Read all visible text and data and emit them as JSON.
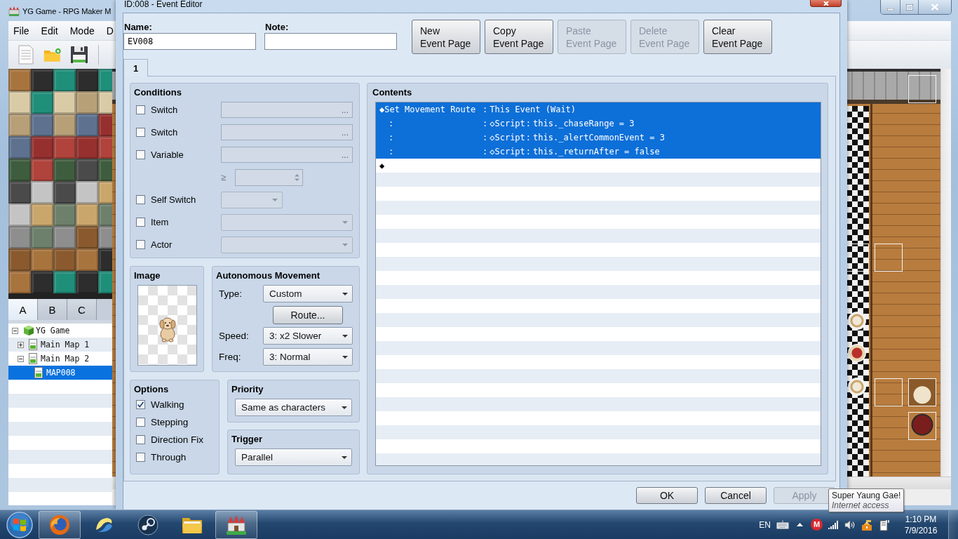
{
  "main_window": {
    "title": "YG Game - RPG Maker M",
    "menu": [
      "File",
      "Edit",
      "Mode",
      "D"
    ],
    "tile_tabs": [
      {
        "label": "A",
        "selected": true
      },
      {
        "label": "B",
        "selected": false
      },
      {
        "label": "C",
        "selected": false
      }
    ],
    "map_tree": [
      {
        "label": "YG Game",
        "kind": "project",
        "expanded": true,
        "selected": false,
        "children": [
          {
            "label": "Main Map 1",
            "kind": "map",
            "expanded": false,
            "selected": false
          },
          {
            "label": "Main Map 2",
            "kind": "map",
            "expanded": true,
            "selected": false,
            "children": [
              {
                "label": "MAP008",
                "kind": "map",
                "selected": true
              }
            ]
          }
        ]
      }
    ]
  },
  "event_editor": {
    "title": "ID:008 - Event Editor",
    "name": {
      "label": "Name:",
      "value": "EV008"
    },
    "note": {
      "label": "Note:"
    },
    "page_buttons": [
      {
        "lines": [
          "New",
          "Event Page"
        ],
        "disabled": false
      },
      {
        "lines": [
          "Copy",
          "Event Page"
        ],
        "disabled": false
      },
      {
        "lines": [
          "Paste",
          "Event Page"
        ],
        "disabled": true
      },
      {
        "lines": [
          "Delete",
          "Event Page"
        ],
        "disabled": true
      },
      {
        "lines": [
          "Clear",
          "Event Page"
        ],
        "disabled": false
      }
    ],
    "page_tabs": [
      {
        "label": "1",
        "selected": true
      }
    ],
    "conditions": {
      "title": "Conditions",
      "rows": [
        {
          "kind": "picker",
          "label": "Switch",
          "checked": false,
          "button": "..."
        },
        {
          "kind": "picker",
          "label": "Switch",
          "checked": false,
          "button": "..."
        },
        {
          "kind": "picker",
          "label": "Variable",
          "checked": false,
          "button": "...",
          "comparison": {
            "operator": "≥"
          }
        },
        {
          "kind": "short_dropdown",
          "label": "Self Switch",
          "checked": false
        },
        {
          "kind": "dropdown",
          "label": "Item",
          "checked": false
        },
        {
          "kind": "dropdown",
          "label": "Actor",
          "checked": false
        }
      ]
    },
    "image": {
      "title": "Image"
    },
    "autonomous_movement": {
      "title": "Autonomous Movement",
      "rows": [
        {
          "kind": "dropdown",
          "label": "Type:",
          "value": "Custom"
        },
        {
          "kind": "button",
          "label": "Route..."
        },
        {
          "kind": "dropdown",
          "label": "Speed:",
          "value": "3: x2 Slower"
        },
        {
          "kind": "dropdown",
          "label": "Freq:",
          "value": "3: Normal"
        }
      ]
    },
    "options": {
      "title": "Options",
      "items": [
        {
          "label": "Walking",
          "checked": true
        },
        {
          "label": "Stepping",
          "checked": false
        },
        {
          "label": "Direction Fix",
          "checked": false
        },
        {
          "label": "Through",
          "checked": false
        }
      ]
    },
    "priority": {
      "title": "Priority",
      "value": "Same as characters"
    },
    "trigger": {
      "title": "Trigger",
      "value": "Parallel"
    },
    "contents": {
      "title": "Contents",
      "rows": [
        {
          "kind": "command",
          "selected": true,
          "cells": [
            "◆Set Movement Route",
            ":",
            "This Event (Wait)"
          ]
        },
        {
          "kind": "continuation",
          "selected": true,
          "cells": [
            ":",
            ":",
            "◇Script",
            ":",
            "this._chaseRange = 3"
          ]
        },
        {
          "kind": "continuation",
          "selected": true,
          "cells": [
            ":",
            ":",
            "◇Script",
            ":",
            "this._alertCommonEvent = 3"
          ]
        },
        {
          "kind": "continuation",
          "selected": true,
          "cells": [
            ":",
            ":",
            "◇Script",
            ":",
            "this._returnAfter = false"
          ]
        },
        {
          "kind": "command",
          "selected": false,
          "cells": [
            "◆"
          ]
        }
      ]
    },
    "buttons": [
      {
        "label": "OK",
        "disabled": false
      },
      {
        "label": "Cancel",
        "disabled": false
      },
      {
        "label": "Apply",
        "disabled": true
      }
    ]
  },
  "tooltip": {
    "title": "Super Yaung Gae!",
    "subtitle": "Internet access"
  },
  "taskbar": {
    "pinned": [
      {
        "kind": "browser",
        "active": true
      },
      {
        "kind": "swirl",
        "active": false
      },
      {
        "kind": "game_client",
        "active": false
      },
      {
        "kind": "file_manager",
        "active": false
      },
      {
        "kind": "editor",
        "active": true
      }
    ],
    "language": "EN",
    "tray_badge": "M",
    "time": "1:10 PM",
    "date": "7/9/2016"
  }
}
